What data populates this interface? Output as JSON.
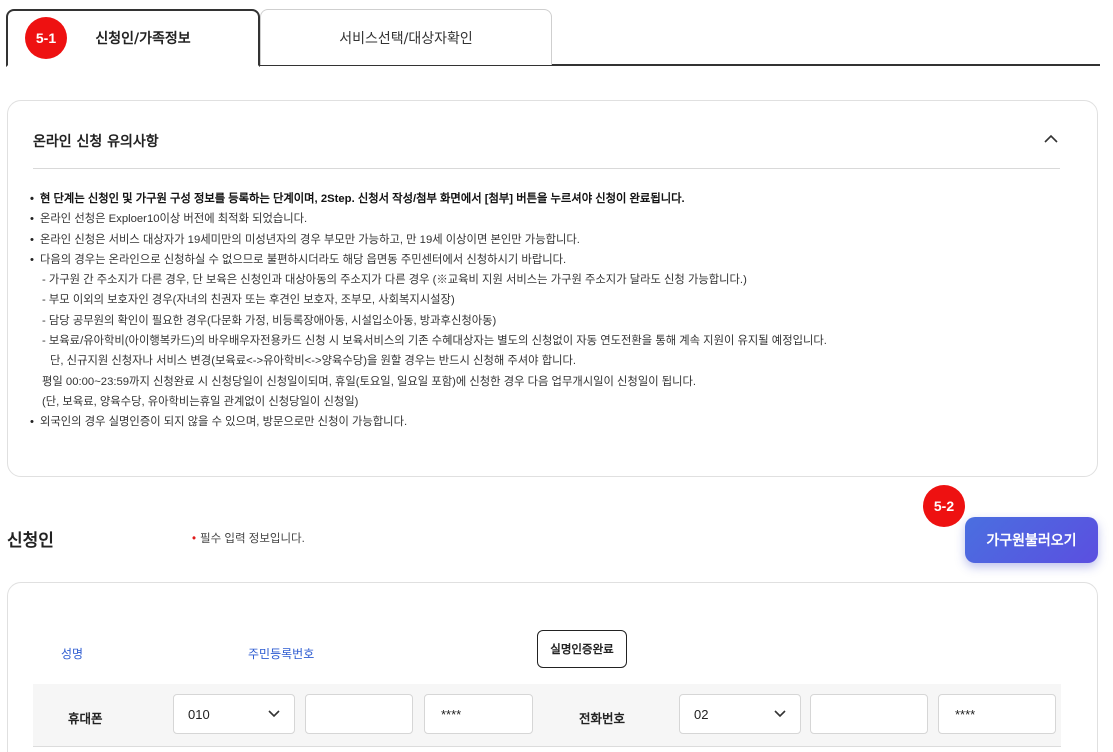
{
  "tabs": [
    {
      "label": "신청인/가족정보",
      "active": true
    },
    {
      "label": "서비스선택/대상자확인",
      "active": false
    }
  ],
  "markers": {
    "m1": "5-1",
    "m2": "5-2"
  },
  "notice": {
    "title": "온라인 신청 유의사항",
    "toggle_icon": "chevron-up-icon",
    "items": [
      "현 단계는 신청인 및 가구원 구성 정보를 등록하는 단계이며, 2Step. 신청서 작성/첨부 화면에서 [첨부] 버튼을 누르셔야 신청이 완료됩니다.",
      "온라인 선청은 Exploer10이상 버전에 최적화 되었습니다.",
      "온라인 신청은 서비스 대상자가 19세미만의 미성년자의 경우 부모만 가능하고, 만 19세 이상이면 본인만 가능합니다.",
      "다음의 경우는 온라인으로 신청하실 수 없으므로 불편하시더라도 해당 읍면동 주민센터에서 신청하시기 바랍니다.",
      "- 가구원 간 주소지가 다른 경우, 단 보육은 신청인과 대상아동의 주소지가 다른 경우 (※교육비 지원 서비스는 가구원 주소지가 달라도 신청 가능합니다.)",
      "- 부모 이외의 보호자인 경우(자녀의 친권자 또는 후견인 보호자, 조부모, 사회복지시설장)",
      "- 담당 공무원의 확인이 필요한 경우(다문화 가정, 비등록장애아동, 시설입소아동, 방과후신청아동)",
      "- 보육료/유아학비(아이행복카드)의 바우배우자전용카드 신청 시 보육서비스의 기존 수혜대상자는 별도의 신청없이 자동 연도전환을 통해 계속 지원이 유지될 예정입니다.",
      "단, 신규지원 신청자나 서비스 변경(보육료<->유아학비<->양육수당)을 원할 경우는 반드시 신청해 주셔야 합니다.",
      "평일 00:00~23:59까지 신청완료 시 신청당일이 신청일이되며, 휴일(토요일, 일요일 포함)에 신청한 경우 다음 업무개시일이 신청일이 됩니다.",
      "(단, 보육료, 양육수당, 유아학비는휴일 관계없이 신청당일이 신청일)",
      "외국인의 경우 실명인증이 되지 않을 수 있으며, 방문으로만 신청이 가능합니다."
    ]
  },
  "applicant": {
    "title": "신청인",
    "required_note": "필수 입력 정보입니다.",
    "load_family_button": "가구원불러오기",
    "name_label": "성명",
    "rrn_label": "주민등록번호",
    "verify_button": "실명인증완료",
    "mobile": {
      "label": "휴대폰",
      "prefix": "010",
      "middle": "",
      "last": "****"
    },
    "phone": {
      "label": "전화번호",
      "prefix": "02",
      "middle": "",
      "last": "****"
    }
  },
  "colors": {
    "accent_blue": "#2c5bd1",
    "button_gradient_start": "#4a6fe0",
    "marker_red": "#ee1111"
  }
}
